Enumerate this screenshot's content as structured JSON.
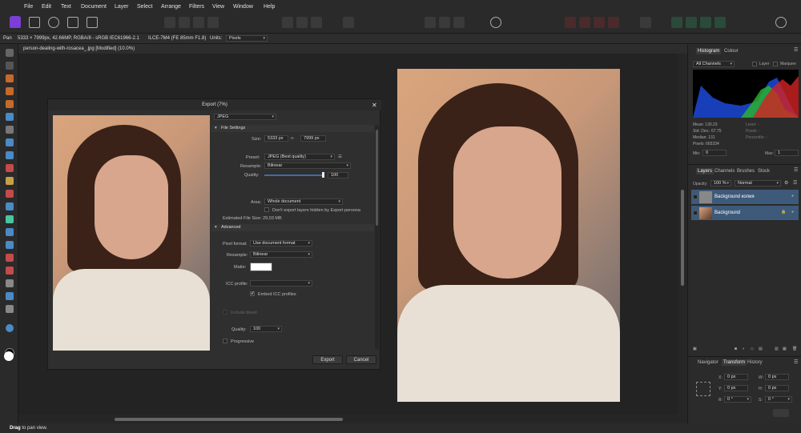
{
  "menu": [
    "File",
    "Edit",
    "Text",
    "Document",
    "Layer",
    "Select",
    "Arrange",
    "Filters",
    "View",
    "Window",
    "Help"
  ],
  "context": {
    "tool": "Pan",
    "info": "5333 × 7999px, 42.66MP, RGBA/8 - sRGB IEC61966-2.1",
    "camera": "ILCE-7M4 (FE 85mm F1.8)",
    "units_label": "Units:",
    "units_value": "Pixels"
  },
  "doc_tab": "person-dealing-with-rosacea_.jpg [Modified] (10.0%)",
  "status": {
    "bold": "Drag",
    "text": " to pan view."
  },
  "dialog": {
    "title": "Export (7%)",
    "format": "JPEG",
    "file_settings": "File Settings",
    "size_label": "Size:",
    "width": "5333 px",
    "height": "7999 px",
    "preset_label": "Preset:",
    "preset": "JPEG (Best quality)",
    "resample_label": "Resample:",
    "resample": "Bilinear",
    "quality_label": "Quality:",
    "quality": "100",
    "area_label": "Area:",
    "area": "Whole document",
    "hidden_layers": "Don't export layers hidden by Export persona",
    "est_size": "Estimated File Size: 29,03 MB",
    "advanced": "Advanced",
    "pixel_format_label": "Pixel format:",
    "pixel_format": "Use document format",
    "resample2_label": "Resample:",
    "resample2": "Bilinear",
    "matte_label": "Matte:",
    "icc_label": "ICC profile:",
    "embed_icc": "Embed ICC profiles",
    "include_bleed": "Include bleed",
    "quality2_label": "Quality:",
    "quality2": "100",
    "progressive": "Progressive",
    "export_btn": "Export",
    "cancel_btn": "Cancel"
  },
  "histogram": {
    "tab1": "Histogram",
    "tab2": "Colour",
    "channel": "All Channels",
    "layer": "Layer",
    "marquee": "Marquee",
    "mean": "Mean: 130.23",
    "std": "Std. Dev.: 67.75",
    "median": "Median: 131",
    "pixels": "Pixels: 665334",
    "level": "Level: -",
    "pixels2": "Pixels: -",
    "percentile": "Percentile: -",
    "min_label": "Min:",
    "min": "0",
    "max_label": "Max:",
    "max": "1"
  },
  "layers": {
    "tabs": [
      "Layers",
      "Channels",
      "Brushes",
      "Stock"
    ],
    "opacity_label": "Opacity:",
    "opacity": "100 %",
    "blend": "Normal",
    "items": [
      "Background копия",
      "Background"
    ]
  },
  "transform": {
    "tabs": [
      "Navigator",
      "Transform",
      "History"
    ],
    "x": "0 px",
    "y": "0 px",
    "w": "0 px",
    "h": "0 px",
    "r": "0 °",
    "s": "0 °"
  },
  "colors": {
    "accent": "#3e5a7a",
    "brand": "#7b3fd6"
  }
}
